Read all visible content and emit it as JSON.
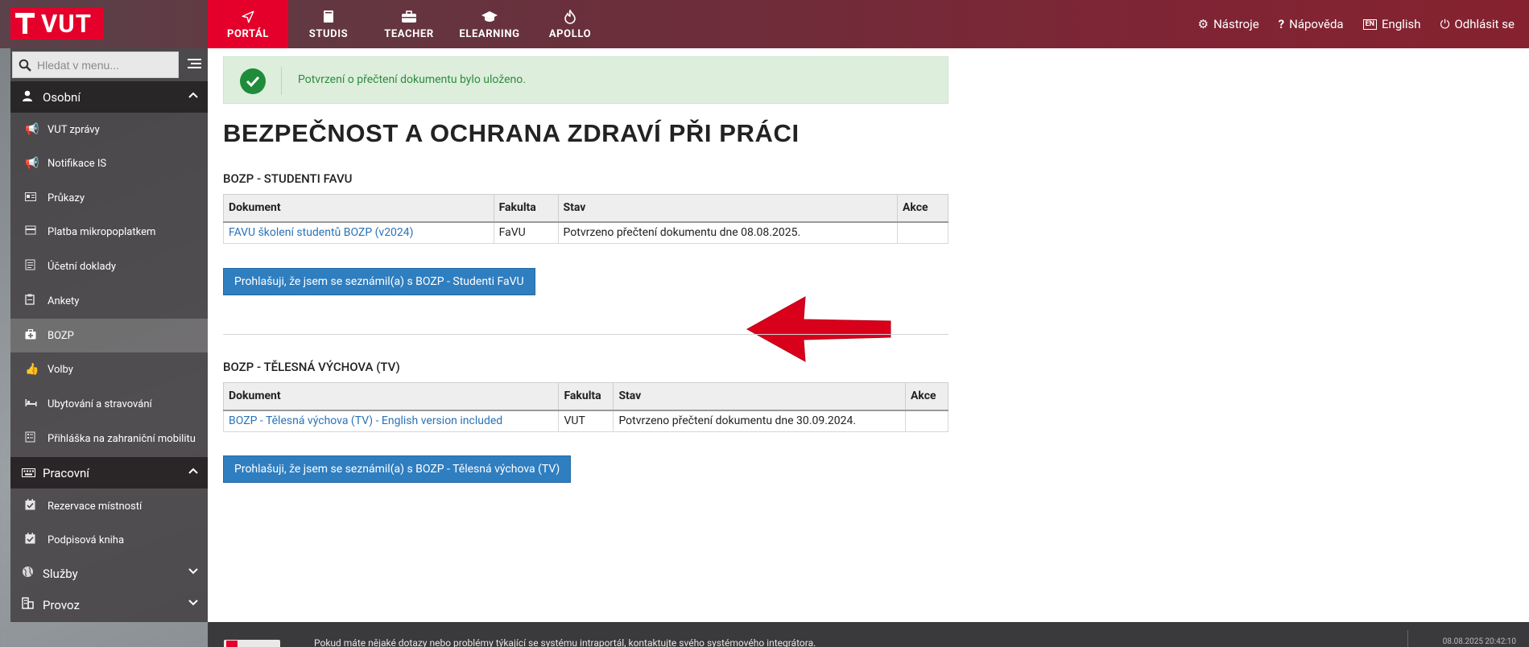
{
  "header": {
    "logo_text": "VUT",
    "modules": [
      {
        "label": "PORTÁL",
        "icon": "paper-plane-icon",
        "active": true
      },
      {
        "label": "STUDIS",
        "icon": "book-icon",
        "active": false
      },
      {
        "label": "TEACHER",
        "icon": "briefcase-icon",
        "active": false
      },
      {
        "label": "ELEARNING",
        "icon": "graduation-cap-icon",
        "active": false
      },
      {
        "label": "APOLLO",
        "icon": "flame-icon",
        "active": false
      }
    ],
    "links": {
      "tools": "Nástroje",
      "help": "Nápověda",
      "language_badge": "EN",
      "language": "English",
      "logout": "Odhlásit se"
    }
  },
  "sidebar": {
    "search_placeholder": "Hledat v menu...",
    "sections": {
      "osobni": "Osobní",
      "pracovni": "Pracovní",
      "sluzby": "Služby",
      "provoz": "Provoz"
    },
    "osobni_items": [
      {
        "label": "VUT zprávy",
        "icon": "megaphone-icon"
      },
      {
        "label": "Notifikace IS",
        "icon": "megaphone-icon"
      },
      {
        "label": "Průkazy",
        "icon": "id-card-icon"
      },
      {
        "label": "Platba mikropoplatkem",
        "icon": "payment-icon"
      },
      {
        "label": "Účetní doklady",
        "icon": "receipt-icon"
      },
      {
        "label": "Ankety",
        "icon": "clipboard-icon"
      },
      {
        "label": "BOZP",
        "icon": "first-aid-icon",
        "active": true
      },
      {
        "label": "Volby",
        "icon": "thumbs-up-icon"
      },
      {
        "label": "Ubytování a stravování",
        "icon": "bed-icon"
      },
      {
        "label": "Přihláška na zahraniční mobilitu",
        "icon": "form-icon"
      }
    ],
    "pracovni_items": [
      {
        "label": "Rezervace místností",
        "icon": "calendar-check-icon"
      },
      {
        "label": "Podpisová kniha",
        "icon": "calendar-check-icon"
      }
    ]
  },
  "main": {
    "alert": "Potvrzení o přečtení dokumentu bylo uloženo.",
    "title": "BEZPEČNOST A OCHRANA ZDRAVÍ PŘI PRÁCI",
    "columns": {
      "document": "Dokument",
      "faculty": "Fakulta",
      "status": "Stav",
      "action": "Akce"
    },
    "section1": {
      "title": "BOZP - STUDENTI FAVU",
      "rows": [
        {
          "document": "FAVU školení studentů BOZP (v2024)",
          "faculty": "FaVU",
          "status": "Potvrzeno přečtení dokumentu dne 08.08.2025.",
          "action": ""
        }
      ],
      "button": "Prohlašuji, že jsem se seznámil(a) s BOZP - Studenti FaVU"
    },
    "section2": {
      "title": "BOZP - TĚLESNÁ VÝCHOVA (TV)",
      "rows": [
        {
          "document": "BOZP - Tělesná výchova (TV) - English version included",
          "faculty": "VUT",
          "status": "Potvrzeno přečtení dokumentu dne 30.09.2024.",
          "action": ""
        }
      ],
      "button": "Prohlašuji, že jsem se seznámil(a) s BOZP - Tělesná výchova (TV)"
    }
  },
  "footer": {
    "text": "Pokud máte nějaké dotazy nebo problémy týkající se systému intraportál, kontaktujte svého systémového integrátora.",
    "datetime": "08.08.2025 20:42:10"
  },
  "colors": {
    "brand_red": "#e4002b",
    "link_blue": "#2a73b8",
    "button_blue": "#2f7ec0",
    "success_green": "#2e8b3b",
    "arrow_red": "#d9001b"
  }
}
